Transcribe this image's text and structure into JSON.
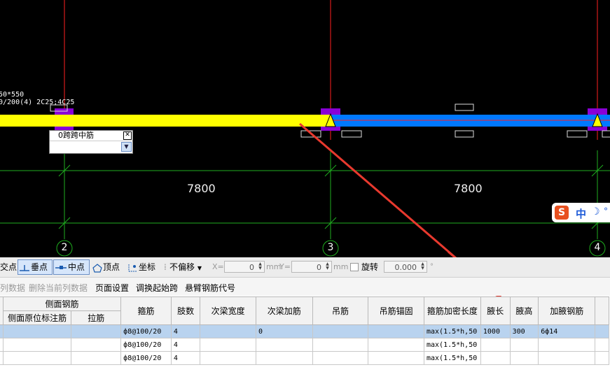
{
  "canvas": {
    "beam_label_line1": "50*550",
    "beam_label_line2": "0/200(4) 2C25;4C25",
    "dimensions": [
      "7800",
      "7800"
    ],
    "axis_labels": [
      "2",
      "3",
      "4"
    ],
    "colors": {
      "background": "#000000",
      "beam_yellow": "#ffff00",
      "beam_blue": "#0078ff",
      "support": "#8a00d6",
      "axis_line": "#ff2020",
      "grid_line": "#1fae1f",
      "annotation_arrow": "#e8392e"
    },
    "popup": {
      "title": "0跨跨中筋",
      "close_icon": "close-icon",
      "dropdown_icon": "chevron-down-icon"
    },
    "ime": {
      "logo": "S",
      "mode": "中",
      "moon_icon": "☽",
      "dot": "°"
    }
  },
  "snapbar": {
    "intersection": "交点",
    "perpendicular": "垂点",
    "midpoint": "中点",
    "vertex": "顶点",
    "coordinate": "坐标",
    "offset_select": "不偏移",
    "x_label": "X=",
    "x_value": "0",
    "x_unit": "mm",
    "y_label": "Y=",
    "y_value": "0",
    "y_unit": "mm",
    "rotate_label": "旋转",
    "rotate_value": "0.000",
    "degree": "°"
  },
  "menubar": {
    "item1": "列数据",
    "item2": "删除当前列数据",
    "item3": "页面设置",
    "item4": "调换起始跨",
    "item5": "悬臂钢筋代号"
  },
  "table": {
    "group_header": "侧面钢筋",
    "headers": {
      "side_origin": "侧面原位标注筋",
      "tie": "拉筋",
      "stirrup": "箍筋",
      "legs": "肢数",
      "sec_width": "次梁宽度",
      "sec_bar": "次梁加筋",
      "hanger": "吊筋",
      "hanger_anchor": "吊筋锚固",
      "dense_len": "箍筋加密长度",
      "haunch_len": "腋长",
      "haunch_height": "腋高",
      "haunch_bar": "加腋钢筋"
    },
    "rows": [
      {
        "side_origin": "",
        "tie": "",
        "stirrup": "ф8@100/20",
        "legs": "4",
        "sec_width": "",
        "sec_bar": "0",
        "hanger": "",
        "hanger_anchor": "",
        "dense_len": "max(1.5*h,50",
        "haunch_len": "1000",
        "haunch_height": "300",
        "haunch_bar": "6ф14"
      },
      {
        "side_origin": "",
        "tie": "",
        "stirrup": "ф8@100/20",
        "legs": "4",
        "sec_width": "",
        "sec_bar": "",
        "hanger": "",
        "hanger_anchor": "",
        "dense_len": "max(1.5*h,50",
        "haunch_len": "",
        "haunch_height": "",
        "haunch_bar": ""
      },
      {
        "side_origin": "",
        "tie": "",
        "stirrup": "ф8@100/20",
        "legs": "4",
        "sec_width": "",
        "sec_bar": "",
        "hanger": "",
        "hanger_anchor": "",
        "dense_len": "max(1.5*h,50",
        "haunch_len": "",
        "haunch_height": "",
        "haunch_bar": ""
      }
    ]
  }
}
